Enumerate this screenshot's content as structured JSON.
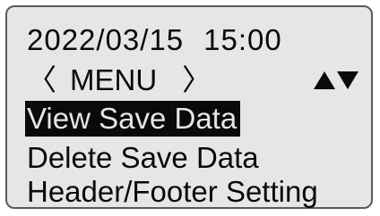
{
  "header": {
    "date": "2022/03/15",
    "time": "15:00"
  },
  "menu": {
    "left_bracket": "〈",
    "title": "MENU",
    "right_bracket": "〉",
    "up_icon": "triangle-up-icon",
    "down_icon": "triangle-down-icon",
    "items": [
      {
        "label": "View Save Data",
        "selected": true
      },
      {
        "label": "Delete Save Data",
        "selected": false
      },
      {
        "label": "Header/Footer Setting",
        "selected": false
      }
    ]
  },
  "colors": {
    "screen_bg": "#e6e6e6",
    "text": "#0a0a0a",
    "border": "#5a5a5a"
  }
}
